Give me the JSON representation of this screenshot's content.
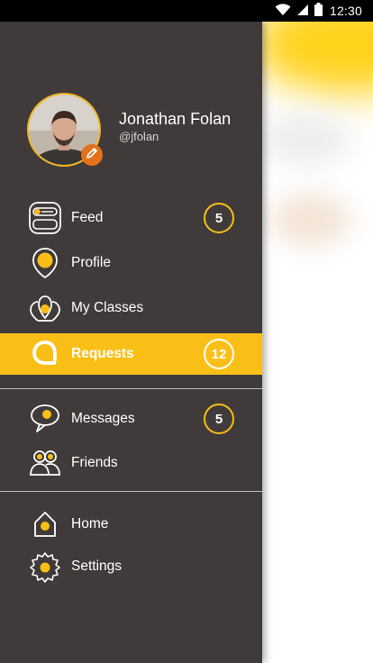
{
  "status_bar": {
    "time": "12:30"
  },
  "profile": {
    "name": "Jonathan Folan",
    "handle": "@jfolan"
  },
  "menu": {
    "primary": [
      {
        "label": "Feed",
        "badge": "5"
      },
      {
        "label": "Profile"
      },
      {
        "label": "My Classes"
      },
      {
        "label": "Requests",
        "badge": "12",
        "active": true
      }
    ],
    "secondary": [
      {
        "label": "Messages",
        "badge": "5"
      },
      {
        "label": "Friends"
      }
    ],
    "tertiary": [
      {
        "label": "Home"
      },
      {
        "label": "Settings"
      }
    ]
  },
  "colors": {
    "accent": "#f9bf17",
    "drawer_bg": "#403b3a",
    "edit_badge": "#e4721c"
  },
  "icons": [
    "wifi-icon",
    "signal-icon",
    "battery-icon",
    "pencil-icon",
    "feed-icon",
    "profile-icon",
    "classes-icon",
    "requests-icon",
    "messages-icon",
    "friends-icon",
    "home-icon",
    "settings-icon"
  ]
}
